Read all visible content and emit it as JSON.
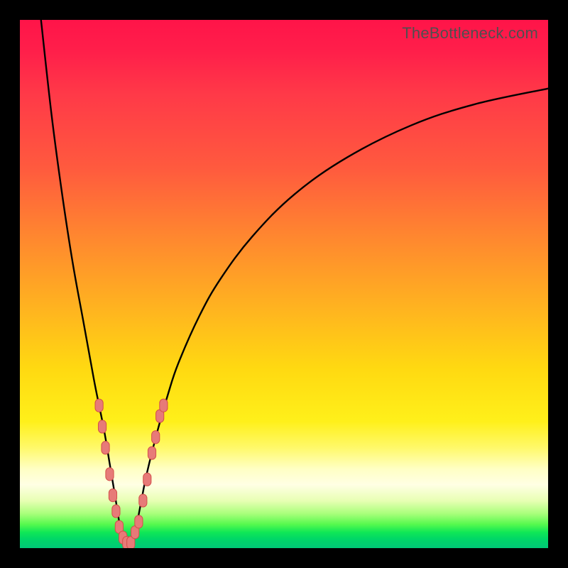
{
  "watermark": "TheBottleneck.com",
  "colors": {
    "frame": "#000000",
    "curve": "#000000",
    "marker_fill": "#e77a78",
    "marker_stroke": "#d34f4a"
  },
  "chart_data": {
    "type": "line",
    "title": "",
    "xlabel": "",
    "ylabel": "",
    "xlim": [
      0,
      100
    ],
    "ylim": [
      0,
      100
    ],
    "ylim_inverted_note": "y=0 is top (worst, red), y≈100 is bottom (best, green); the V-shape is a bottleneck mismatch curve where the minimum near x≈20 marks the balanced point.",
    "series": [
      {
        "name": "bottleneck-curve",
        "x": [
          4,
          6,
          8,
          10,
          12,
          14,
          15,
          16,
          17,
          18,
          19,
          20,
          21,
          22,
          23,
          24,
          26,
          28,
          30,
          34,
          38,
          44,
          52,
          62,
          74,
          86,
          100
        ],
        "y": [
          0,
          18,
          33,
          46,
          57,
          68,
          73,
          78,
          84,
          90,
          96,
          99,
          99,
          96,
          91,
          86,
          78,
          71,
          65,
          56,
          49,
          41,
          33,
          26,
          20,
          16,
          13
        ]
      }
    ],
    "markers": {
      "name": "highlighted-points",
      "style": "pill",
      "approx_radius_px": 7,
      "points": [
        {
          "x": 15.0,
          "y": 73
        },
        {
          "x": 15.6,
          "y": 77
        },
        {
          "x": 16.2,
          "y": 81
        },
        {
          "x": 17.0,
          "y": 86
        },
        {
          "x": 17.6,
          "y": 90
        },
        {
          "x": 18.2,
          "y": 93
        },
        {
          "x": 18.8,
          "y": 96
        },
        {
          "x": 19.5,
          "y": 98
        },
        {
          "x": 20.2,
          "y": 99
        },
        {
          "x": 21.0,
          "y": 99
        },
        {
          "x": 21.8,
          "y": 97
        },
        {
          "x": 22.5,
          "y": 95
        },
        {
          "x": 23.3,
          "y": 91
        },
        {
          "x": 24.1,
          "y": 87
        },
        {
          "x": 25.0,
          "y": 82
        },
        {
          "x": 25.7,
          "y": 79
        },
        {
          "x": 26.5,
          "y": 75
        },
        {
          "x": 27.2,
          "y": 73
        }
      ]
    },
    "gradient_stops": [
      {
        "pos": 0.0,
        "color": "#ff1449"
      },
      {
        "pos": 0.28,
        "color": "#ff5a3e"
      },
      {
        "pos": 0.56,
        "color": "#ffb81e"
      },
      {
        "pos": 0.76,
        "color": "#fff01a"
      },
      {
        "pos": 0.88,
        "color": "#ffffe4"
      },
      {
        "pos": 0.95,
        "color": "#56f94e"
      },
      {
        "pos": 1.0,
        "color": "#00c877"
      }
    ]
  }
}
